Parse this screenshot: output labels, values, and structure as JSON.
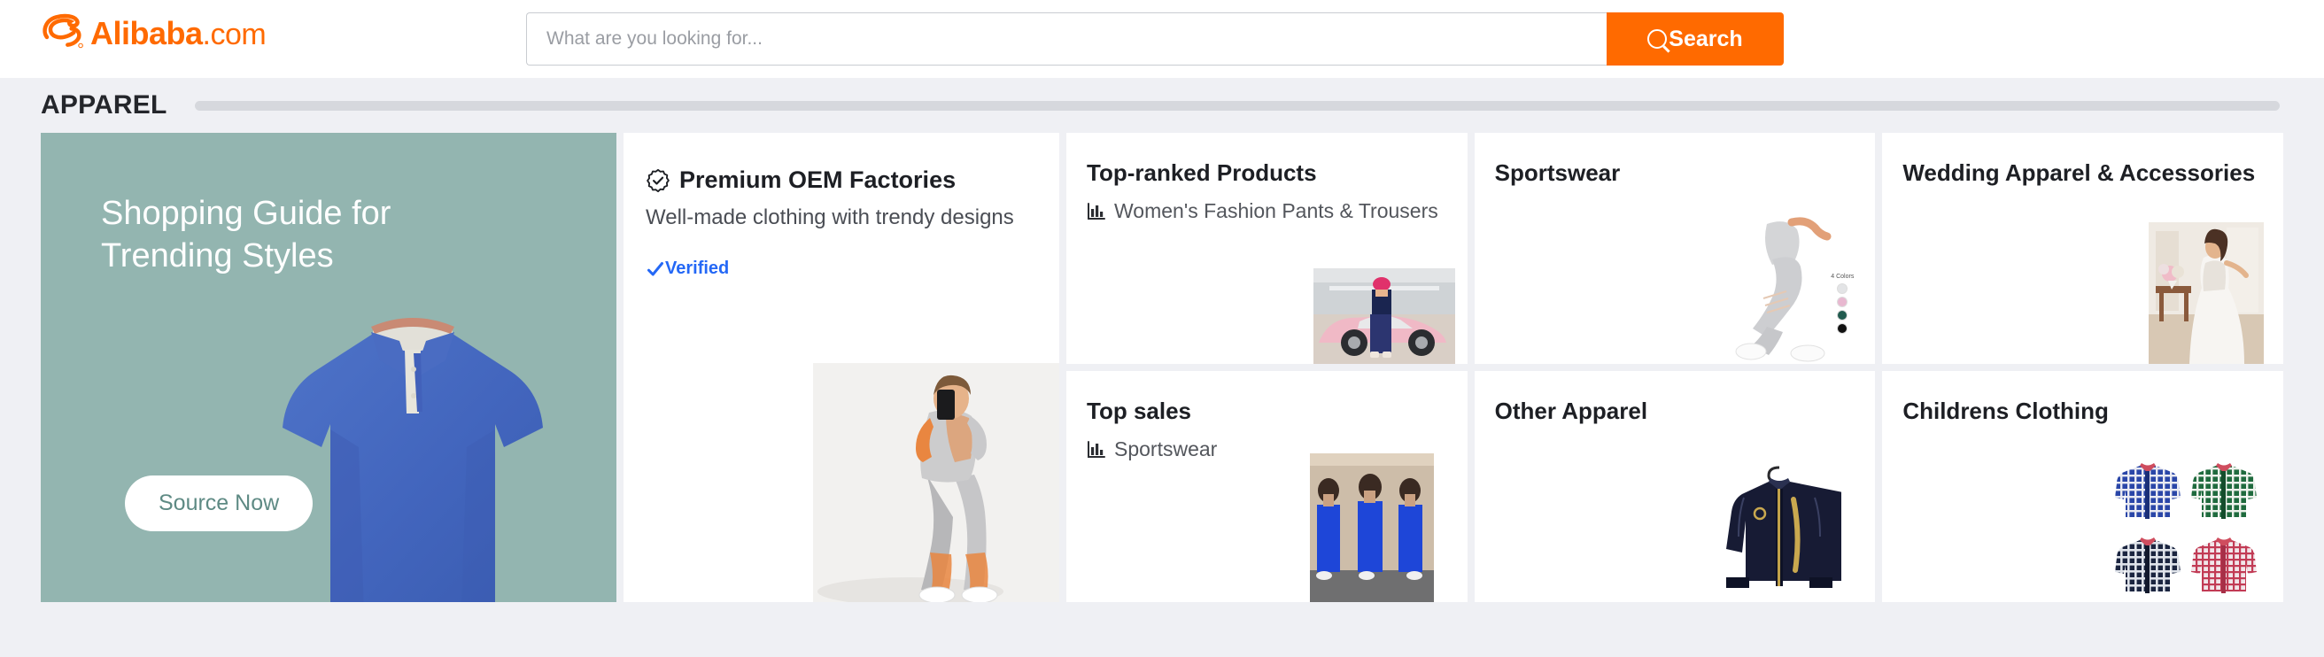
{
  "header": {
    "brand_name": "Alibaba",
    "brand_tld": ".com",
    "logo_icon": "alibaba-logo-icon",
    "search": {
      "placeholder": "What are you looking for...",
      "value": "",
      "button_label": "Search",
      "button_icon": "search-icon",
      "accent_color": "#ff6a00"
    }
  },
  "section": {
    "title": "APPAREL",
    "rule_color": "#d6d8dd",
    "background_color": "#eff0f4"
  },
  "banner": {
    "title": "Shopping Guide for Trending Styles",
    "cta_label": "Source Now",
    "background_color": "#93b5b0",
    "product_image": "blue-polo-shirt-image"
  },
  "oem_card": {
    "title": "Premium OEM Factories",
    "title_icon": "verified-badge-icon",
    "subtitle": "Well-made clothing with trendy designs",
    "verified_label": "Verified",
    "verified_icon": "blue-check-icon",
    "verified_color": "#2468f6",
    "product_image": "woman-in-grey-activewear-set-image"
  },
  "cells": [
    {
      "title": "Top-ranked Products",
      "subtitle": "Women's Fashion Pants & Trousers",
      "subtitle_icon": "bar-chart-icon",
      "product_image": "person-in-patterned-joggers-with-pink-sportscar-image"
    },
    {
      "title": "Sportswear",
      "subtitle": "",
      "subtitle_icon": "",
      "product_image": "grey-leggings-on-model-image",
      "swatch_label": "4 Colors",
      "swatches": [
        "#e3e4e6",
        "#e8b8d0",
        "#215a4e",
        "#111111"
      ]
    },
    {
      "title": "Wedding Apparel & Accessories",
      "subtitle": "",
      "subtitle_icon": "",
      "product_image": "bride-in-white-lace-gown-image"
    },
    {
      "title": "Top sales",
      "subtitle": "Sportswear",
      "subtitle_icon": "bar-chart-icon",
      "product_image": "blue-two-piece-tracksuit-set-image"
    },
    {
      "title": "Other Apparel",
      "subtitle": "",
      "subtitle_icon": "",
      "product_image": "navy-champion-track-jacket-image"
    },
    {
      "title": "Childrens Clothing",
      "subtitle": "",
      "subtitle_icon": "",
      "product_image": "four-plaid-kids-shirts-image",
      "shirt_colors": [
        "#2a46a8",
        "#1f6b3e",
        "#1b2540",
        "#c23b55"
      ]
    }
  ]
}
